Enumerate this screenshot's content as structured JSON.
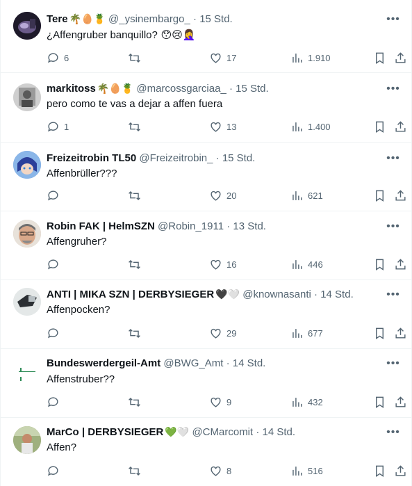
{
  "tweets": [
    {
      "name": "Tere",
      "name_emoji": "🌴🥚🍍",
      "handle": "@_ysinembargo_",
      "dot": "·",
      "time": "15 Std.",
      "text": "¿Affengruber banquillo?",
      "text_emoji": " 😯😢🤦‍♀️",
      "replies": "6",
      "retweets": "",
      "likes": "17",
      "views": "1.910"
    },
    {
      "name": "markitoss",
      "name_emoji": "🌴🥚🍍",
      "handle": "@marcossgarciaa_",
      "dot": "·",
      "time": "15 Std.",
      "text": "pero como te vas a dejar a affen fuera",
      "text_emoji": "",
      "replies": "1",
      "retweets": "",
      "likes": "13",
      "views": "1.400"
    },
    {
      "name": "Freizeitrobin TL50",
      "name_emoji": "",
      "handle": "@Freizeitrobin_",
      "dot": "·",
      "time": "15 Std.",
      "text": "Affenbrüller???",
      "text_emoji": "",
      "replies": "",
      "retweets": "",
      "likes": "20",
      "views": "621"
    },
    {
      "name": "Robin FAK | HelmSZN",
      "name_emoji": "",
      "handle": "@Robin_1911",
      "dot": "·",
      "time": "13 Std.",
      "text": "Affengruher?",
      "text_emoji": "",
      "replies": "",
      "retweets": "",
      "likes": "16",
      "views": "446"
    },
    {
      "name": "ANTI | MIKA SZN | DERBYSIEGER",
      "name_emoji": "🖤🤍",
      "handle": "@knownasanti",
      "dot": "·",
      "time": "14 Std.",
      "text": "Affenpocken?",
      "text_emoji": "",
      "replies": "",
      "retweets": "",
      "likes": "29",
      "views": "677"
    },
    {
      "name": "Bundeswerdergeil-Amt",
      "name_emoji": "",
      "handle": "@BWG_Amt",
      "dot": "·",
      "time": "14 Std.",
      "text": "Affenstruber??",
      "text_emoji": "",
      "replies": "",
      "retweets": "",
      "likes": "9",
      "views": "432"
    },
    {
      "name": "MarCo | DERBYSIEGER",
      "name_emoji": "💚🤍",
      "handle": "@CMarcomit",
      "dot": "·",
      "time": "14 Std.",
      "text": "Affen?",
      "text_emoji": "",
      "replies": "",
      "retweets": "",
      "likes": "8",
      "views": "516"
    }
  ],
  "colors": {
    "text": "#0f1419",
    "secondary": "#536471",
    "border": "#eff3f4"
  },
  "icons": [
    "reply-icon",
    "retweet-icon",
    "like-icon",
    "views-icon",
    "bookmark-icon",
    "share-icon",
    "more-icon"
  ]
}
